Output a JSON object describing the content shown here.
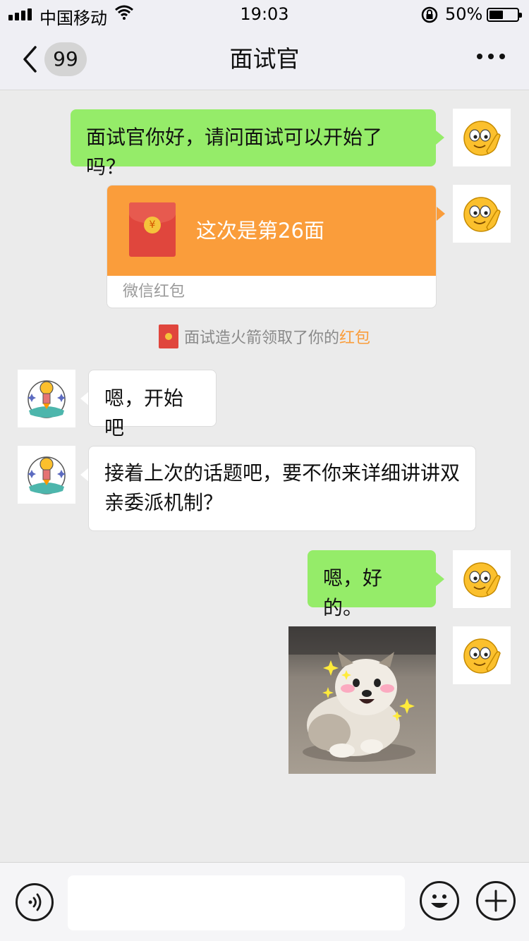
{
  "status_bar": {
    "carrier": "中国移动",
    "time": "19:03",
    "battery_percent": "50%",
    "icons": [
      "signal-icon",
      "wifi-icon",
      "rotation-lock-icon",
      "battery-icon"
    ]
  },
  "nav": {
    "unread_count": "99",
    "title": "面试官",
    "icons": [
      "back-chevron-icon",
      "more-dots-icon"
    ]
  },
  "messages": [
    {
      "side": "right",
      "type": "text",
      "bubble_color": "#95ec69",
      "avatar": "smiling-emoji-avatar",
      "text": "面试官你好，请问面试可以开始了吗？"
    },
    {
      "side": "right",
      "type": "red-packet",
      "avatar": "smiling-emoji-avatar",
      "title": "这次是第26面",
      "footer": "微信红包"
    },
    {
      "side": "left",
      "type": "text",
      "avatar": "rocket-lightbulb-avatar",
      "text": "嗯，开始吧"
    },
    {
      "side": "left",
      "type": "text",
      "avatar": "rocket-lightbulb-avatar",
      "lines": [
        "接着上次的话题吧，要不你来详细讲讲双",
        "亲委派机制？"
      ]
    },
    {
      "side": "right",
      "type": "text",
      "bubble_color": "#95ec69",
      "avatar": "smiling-emoji-avatar",
      "text": "嗯，好的。"
    },
    {
      "side": "right",
      "type": "image",
      "avatar": "smiling-emoji-avatar",
      "image": "fluffy-puppy-running-sticker"
    }
  ],
  "system_note": {
    "text": "面试造火箭领取了你的",
    "highlight": "红包",
    "highlight_color": "#fa9d3b"
  },
  "input_bar": {
    "value": "",
    "icons": [
      "voice-icon",
      "emoji-icon",
      "plus-icon"
    ]
  },
  "colors": {
    "chat_background": "#ebebeb",
    "sent_bubble": "#95ec69",
    "red_packet": "#fa9d3b"
  }
}
